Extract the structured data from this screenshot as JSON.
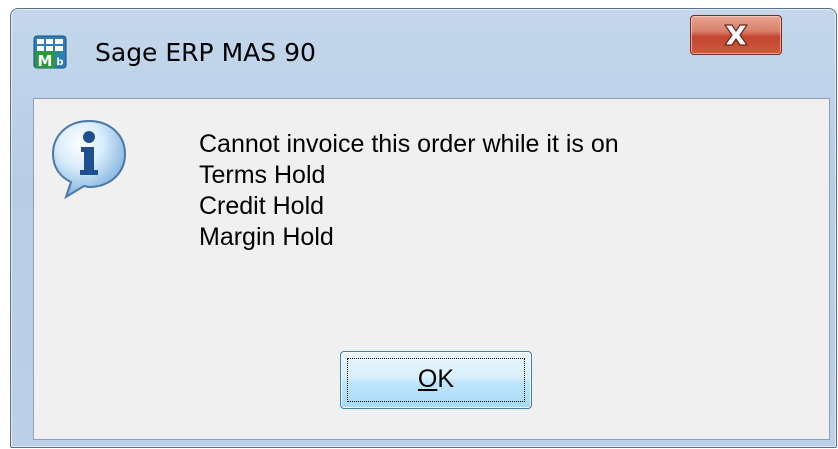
{
  "window": {
    "title": "Sage ERP MAS 90",
    "app_icon": "mas90-app-icon",
    "close_icon": "close-x-icon"
  },
  "dialog": {
    "icon": "information-icon",
    "message_lines": [
      "Cannot invoice this order while it is on",
      "Terms Hold",
      "Credit Hold",
      "Margin Hold"
    ],
    "ok_button": {
      "mnemonic": "O",
      "rest": "K"
    }
  },
  "colors": {
    "title_bar": "#bcd0e8",
    "close_button": "#c24630",
    "dialog_background": "#f0f0f0",
    "ok_button": "#bee6fd"
  }
}
